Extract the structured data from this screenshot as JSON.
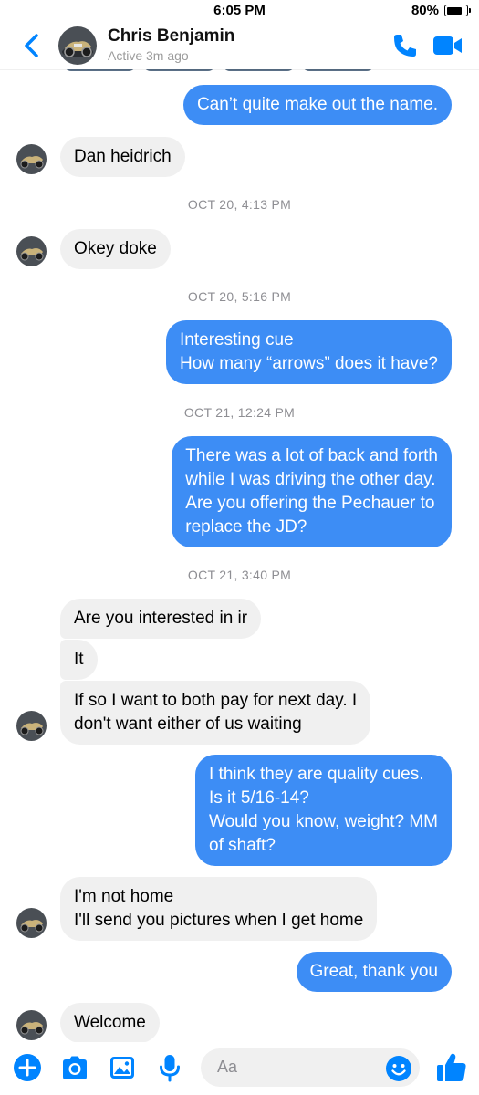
{
  "status_bar": {
    "time": "6:05 PM",
    "battery": "80%",
    "battery_level": 0.8
  },
  "header": {
    "name": "Chris Benjamin",
    "status": "Active 3m ago"
  },
  "messages": [
    {
      "type": "out",
      "text": "Can’t quite make out the name."
    },
    {
      "type": "in",
      "text": "Dan heidrich"
    },
    {
      "type": "timestamp",
      "text": "OCT 20, 4:13 PM"
    },
    {
      "type": "in",
      "text": "Okey doke"
    },
    {
      "type": "timestamp",
      "text": "OCT 20, 5:16 PM"
    },
    {
      "type": "out",
      "text": "Interesting cue\nHow many “arrows” does it have?"
    },
    {
      "type": "timestamp",
      "text": "OCT 21, 12:24 PM"
    },
    {
      "type": "out",
      "text": "There was a lot of back and forth\nwhile I was driving the other day.\nAre you offering the Pechauer to\nreplace the JD?"
    },
    {
      "type": "timestamp",
      "text": "OCT 21, 3:40 PM"
    },
    {
      "type": "in",
      "text": "Are you interested in ir"
    },
    {
      "type": "in",
      "text": "It"
    },
    {
      "type": "in",
      "text": "If so I want to both pay for next day. I\ndon't want either of us waiting"
    },
    {
      "type": "out",
      "text": "I think they are quality cues.\nIs it 5/16-14?\nWould you know, weight? MM\nof shaft?"
    },
    {
      "type": "in",
      "text": "I'm not home\nI'll send you pictures when I get home"
    },
    {
      "type": "out",
      "text": "Great, thank you"
    },
    {
      "type": "in",
      "text": "Welcome"
    }
  ],
  "composer": {
    "placeholder": "Aa"
  },
  "icons": {
    "back": "chevron-left-icon",
    "call": "phone-icon",
    "video": "video-camera-icon",
    "plus": "plus-circle-icon",
    "camera": "camera-icon",
    "photo": "photo-icon",
    "mic": "microphone-icon",
    "emoji": "smiley-icon",
    "like": "thumbs-up-icon"
  },
  "colors": {
    "accent": "#0084ff",
    "outgoing_bubble": "#3d8df5",
    "incoming_bubble": "#f0f0f0"
  }
}
